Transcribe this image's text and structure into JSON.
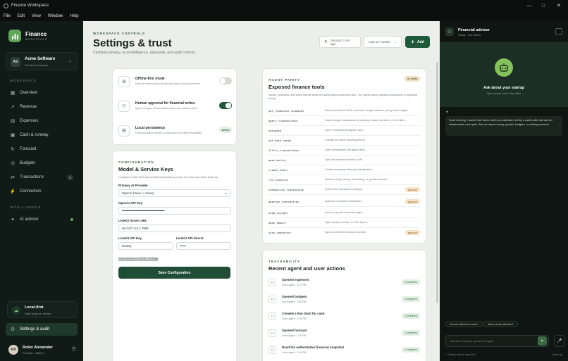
{
  "window": {
    "title": "Finance Workspace"
  },
  "menu": [
    "File",
    "Edit",
    "View",
    "Window",
    "Help"
  ],
  "sidebar": {
    "brand": "Finance",
    "brand_sub": "WORKSPACE",
    "workspace": {
      "initials": "AS",
      "name": "Acme Software",
      "sub": "Growth workspace"
    },
    "section_workspace": "WORKSPACE",
    "items": [
      {
        "label": "Overview",
        "icon": "grid-icon"
      },
      {
        "label": "Revenue",
        "icon": "trend-icon"
      },
      {
        "label": "Expenses",
        "icon": "receipt-icon"
      },
      {
        "label": "Cash & runway",
        "icon": "wallet-icon"
      },
      {
        "label": "Forecast",
        "icon": "forecast-icon"
      },
      {
        "label": "Budgets",
        "icon": "target-icon"
      },
      {
        "label": "Transactions",
        "icon": "transfer-icon",
        "badge": "3"
      },
      {
        "label": "Connectors",
        "icon": "plug-icon"
      }
    ],
    "section_intelligence": "INTELLIGENCE",
    "ai_advisor": "AI advisor",
    "local_first": {
      "title": "Local-first",
      "sub": "Data stays on device"
    },
    "settings": "Settings & audit",
    "user": {
      "initials": "RA",
      "name": "Rolex Alexander",
      "role": "Founder · Admin"
    }
  },
  "header": {
    "eyebrow": "WORKSPACE CONTROLS",
    "title": "Settings & trust",
    "subtitle": "Configure privacy, local intelligence, approvals, and audit controls.",
    "synced": "Synced 2 min ago",
    "range": "Last 12 months",
    "add": "Add"
  },
  "toggles": [
    {
      "title": "Offline-first mode",
      "sub": "Keep all reasoning on-device and pause cloud connectors.",
      "on": false
    },
    {
      "title": "Human approval for financial writes",
      "sub": "Agent changes remain drafts until a user confirms them.",
      "on": true
    },
    {
      "title": "Local persistence",
      "sub": "Financial state is stored on this device for offline availability.",
      "status": "Active"
    }
  ],
  "config": {
    "eyebrow": "CONFIGURATION",
    "title": "Model & Service Keys",
    "desc": "Configure model APIs and LiveKit credentials to power the voice and vision features.",
    "primary_label": "Primary AI Provider",
    "primary_value": "OpenAI (Voice + Vision)",
    "openai_label": "OpenAI API Key",
    "openai_value": "••••••••••••••••••••••••••••••••••••••••••••••••••••••••••••",
    "livekit_url_label": "LiveKit Server URL",
    "livekit_url_value": "ws://127.0.0.1:7880",
    "livekit_key_label": "LiveKit API Key",
    "livekit_key_value": "devkey",
    "livekit_secret_label": "LiveKit API Secret",
    "livekit_secret_value": "••••••",
    "advanced": "Show Advanced Model Settings",
    "save": "Save Configuration"
  },
  "tools": {
    "eyebrow": "AGENT PARITY",
    "title": "Exposed finance tools",
    "count": "13 tools",
    "desc": "Mouse, keyboard, and voice actions share the same typed command layer. The agent cannot bypass permissions or approval policy.",
    "rows": [
      {
        "name": "get_financial_snapshot",
        "desc": "Read authoritative KPIs, forecasts, budget variance, and growth insights."
      },
      {
        "name": "query_transactions",
        "desc": "Search ledger transactions by category, status, direction, or text filters."
      },
      {
        "name": "navigate",
        "desc": "Open a financial workspace view."
      },
      {
        "name": "set_date_range",
        "desc": "Change the active reporting period."
      },
      {
        "name": "filter_transactions",
        "desc": "Open transactions and apply filters."
      },
      {
        "name": "open_metric",
        "desc": "Open the evidence behind a KPI."
      },
      {
        "name": "create_chart",
        "desc": "Create a requested financial visualization."
      },
      {
        "name": "run_scenario",
        "desc": "Model a hiring, pricing, fundraising, or growth scenario."
      },
      {
        "name": "categorize_transaction",
        "desc": "Draft a new transaction category.",
        "approval": "approval"
      },
      {
        "name": "approve_transaction",
        "desc": "Approve a reviewed transaction.",
        "approval": "approval"
      },
      {
        "name": "show_insight",
        "desc": "Focus a specific financial insight."
      },
      {
        "name": "open_import",
        "desc": "Open receipt, invoice, or CSV import."
      },
      {
        "name": "sync_connector",
        "desc": "Sync a connected financial provider.",
        "approval": "approval"
      }
    ]
  },
  "trace": {
    "eyebrow": "TRACEABILITY",
    "title": "Recent agent and user actions",
    "rows": [
      {
        "title": "Opened expenses",
        "sub": "Voice agent · 2:01 PM",
        "status": "Completed"
      },
      {
        "title": "Opened budgets",
        "sub": "Voice agent · 2:00 PM",
        "status": "Completed"
      },
      {
        "title": "Created a line chart for cash",
        "sub": "Voice agent · 2:00 PM",
        "status": "Completed"
      },
      {
        "title": "Opened forecast",
        "sub": "Voice agent · 2:00 PM",
        "status": "Completed"
      },
      {
        "title": "Read the authoritative financial snapshot",
        "sub": "Voice agent · 2:00 PM",
        "status": "Completed"
      }
    ]
  },
  "advisor": {
    "title": "Financial advisor",
    "status": "Ready · Live follows",
    "hero_title": "Ask about your startup",
    "hero_sub": "Open secure voice, fully offline",
    "message": "Good evening. I found three items worth your attention, led by a cash-buffer risk and an infrastructure cost spike. Ask me about runway, growth, budgets, or a hiring scenario.",
    "suggestions": [
      "Can we afford two hires?",
      "What needs attention?"
    ],
    "placeholder": "Ask about runway, growth, budgets...",
    "footer_left": "Writes require approval",
    "footer_right": "Audit log"
  }
}
